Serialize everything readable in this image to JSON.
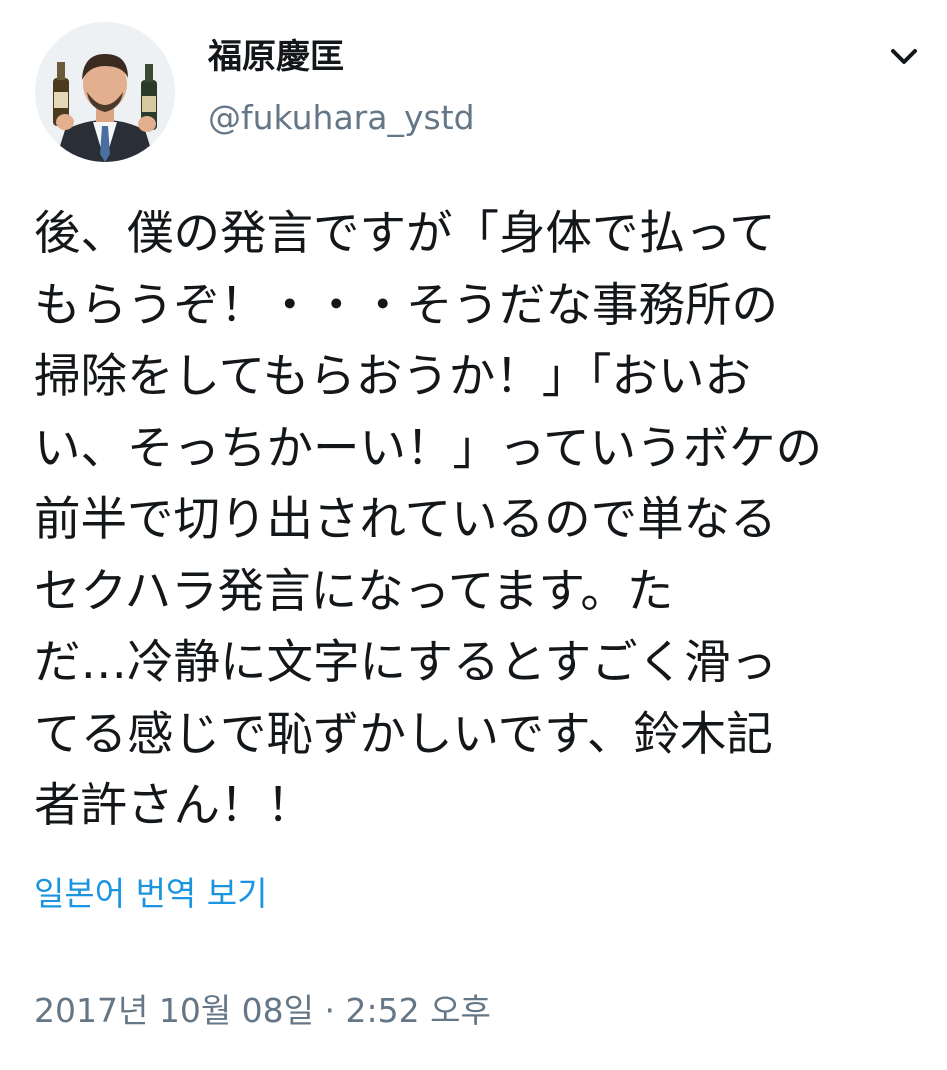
{
  "author": {
    "display_name": "福原慶匡",
    "handle": "@fukuhara_ystd"
  },
  "tweet": {
    "lines": [
      "後、僕の発言ですが「身体で払って",
      "もらうぞ！・・・そうだな事務所の",
      "掃除をしてもらおうか！」「おいお",
      "い、そっちかーい！」っていうボケの",
      "前半で切り出されているので単なる",
      "セクハラ発言になってます。た",
      "だ…冷静に文字にするとすごく滑っ",
      "てる感じで恥ずかしいです、鈴木記",
      "者許さん！！"
    ]
  },
  "translate_link": "일본어 번역 보기",
  "timestamp": "2017년 10월 08일 · 2:52 오후",
  "icons": {
    "menu": "chevron-down-icon",
    "avatar": "avatar"
  },
  "colors": {
    "text": "#14171a",
    "secondary": "#657786",
    "link": "#1b95e0"
  }
}
